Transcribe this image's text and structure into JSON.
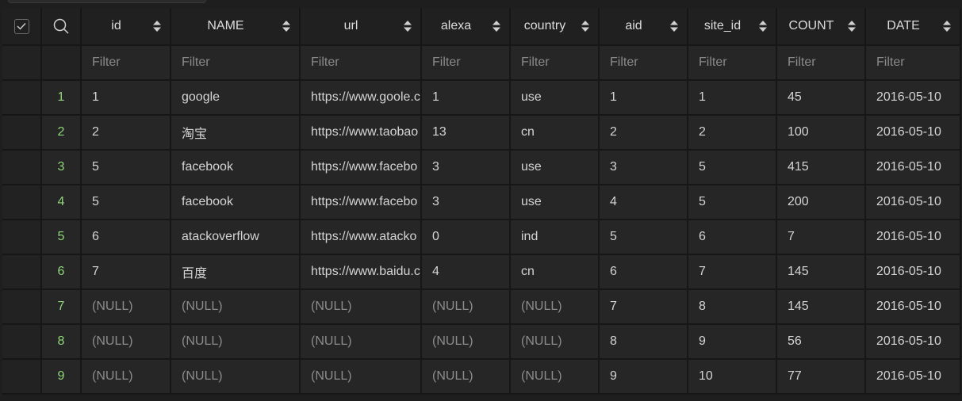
{
  "columns": [
    "id",
    "NAME",
    "url",
    "alexa",
    "country",
    "aid",
    "site_id",
    "COUNT",
    "DATE"
  ],
  "filter_placeholder": "Filter",
  "rows": [
    {
      "num": "1",
      "cells": [
        "1",
        "google",
        "https://www.goole.c",
        "1",
        "use",
        "1",
        "1",
        "45",
        "2016-05-10"
      ]
    },
    {
      "num": "2",
      "cells": [
        "2",
        "淘宝",
        "https://www.taobao",
        "13",
        "cn",
        "2",
        "2",
        "100",
        "2016-05-10"
      ]
    },
    {
      "num": "3",
      "cells": [
        "5",
        "facebook",
        "https://www.facebo",
        "3",
        "use",
        "3",
        "5",
        "415",
        "2016-05-10"
      ]
    },
    {
      "num": "4",
      "cells": [
        "5",
        "facebook",
        "https://www.facebo",
        "3",
        "use",
        "4",
        "5",
        "200",
        "2016-05-10"
      ]
    },
    {
      "num": "5",
      "cells": [
        "6",
        "atackoverflow",
        "https://www.atacko",
        "0",
        "ind",
        "5",
        "6",
        "7",
        "2016-05-10"
      ]
    },
    {
      "num": "6",
      "cells": [
        "7",
        "百度",
        "https://www.baidu.c",
        "4",
        "cn",
        "6",
        "7",
        "145",
        "2016-05-10"
      ]
    },
    {
      "num": "7",
      "cells": [
        "(NULL)",
        "(NULL)",
        "(NULL)",
        "(NULL)",
        "(NULL)",
        "7",
        "8",
        "145",
        "2016-05-10"
      ]
    },
    {
      "num": "8",
      "cells": [
        "(NULL)",
        "(NULL)",
        "(NULL)",
        "(NULL)",
        "(NULL)",
        "8",
        "9",
        "56",
        "2016-05-10"
      ]
    },
    {
      "num": "9",
      "cells": [
        "(NULL)",
        "(NULL)",
        "(NULL)",
        "(NULL)",
        "(NULL)",
        "9",
        "10",
        "77",
        "2016-05-10"
      ]
    }
  ],
  "colors": {
    "background": "#1e1e1e",
    "cell": "#262626",
    "row_number": "#8fd67a",
    "null_text": "#8c8c8c",
    "filter_text": "#8a8a8a"
  },
  "icons": {
    "select_all": "checkmark-icon",
    "search": "search-icon",
    "sort": "sort-updown-icon"
  }
}
